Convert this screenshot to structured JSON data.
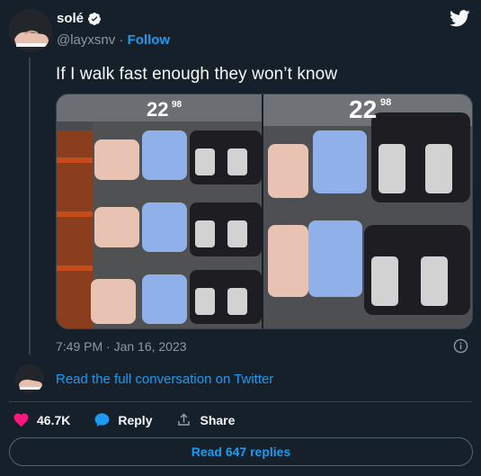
{
  "author": {
    "display_name": "solé",
    "handle": "@layxsnv",
    "separator": "·",
    "follow_label": "Follow"
  },
  "tweet": {
    "text": "If I walk fast enough they won’t know",
    "timestamp": "7:49 PM · Jan 16, 2023",
    "media": {
      "left_price": "22",
      "left_cents": "98",
      "right_price": "22",
      "right_cents": "98"
    }
  },
  "conversation": {
    "link_label": "Read the full conversation on Twitter"
  },
  "actions": {
    "like_count": "46.7K",
    "reply_label": "Reply",
    "share_label": "Share"
  },
  "replies_button": {
    "label": "Read 647 replies"
  },
  "colors": {
    "background": "#15202b",
    "accent": "#1d9bf0",
    "like": "#f91880",
    "muted": "#8b98a5"
  }
}
